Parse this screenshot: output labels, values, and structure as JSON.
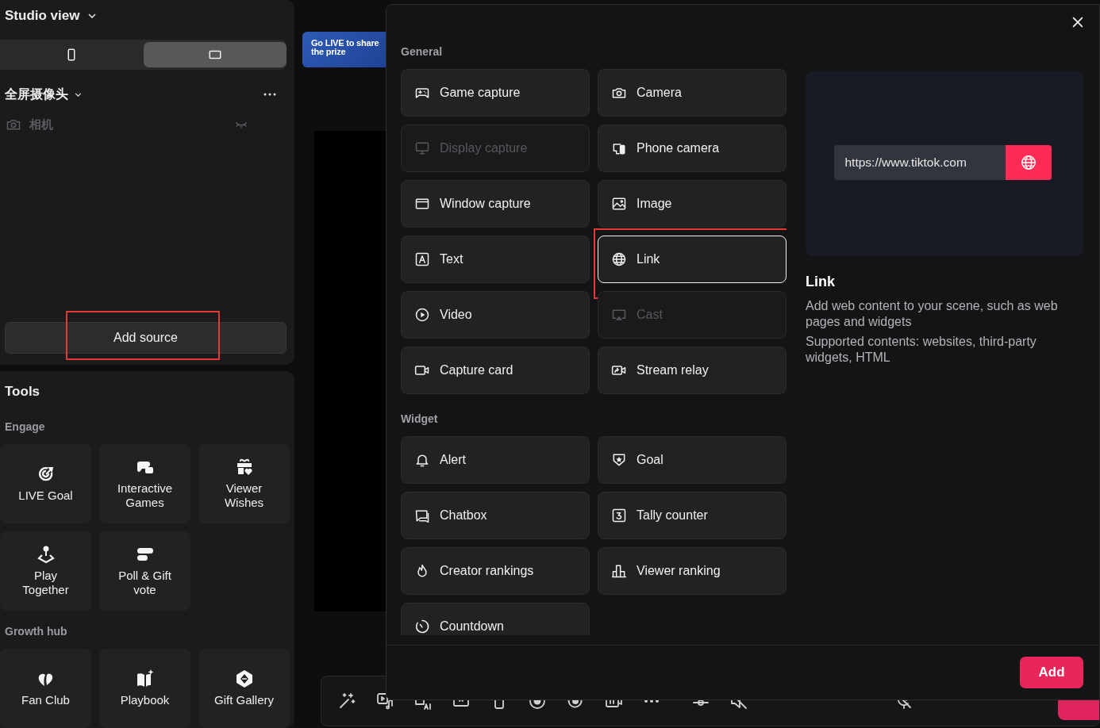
{
  "sidebar": {
    "title": "Studio view",
    "layout_tabs": [
      {
        "selected": false
      },
      {
        "selected": true
      }
    ],
    "scene": {
      "name": "全屏摄像头"
    },
    "sources": [
      {
        "name": "相机",
        "visible": false
      }
    ],
    "add_source": {
      "label": "Add source",
      "annotated": true
    }
  },
  "tools": {
    "title": "Tools",
    "groups": [
      {
        "title": "Engage",
        "items": [
          "LIVE Goal",
          "Interactive Games",
          "Viewer Wishes",
          "Play Together",
          "Poll & Gift vote"
        ]
      },
      {
        "title": "Growth hub",
        "items": [
          "Fan Club",
          "Playbook",
          "Gift Gallery"
        ]
      }
    ]
  },
  "banner": {
    "text": "Go LIVE to share the prize"
  },
  "dialog": {
    "sections": [
      {
        "title": "General",
        "items": [
          {
            "label": "Game capture",
            "disabled": false,
            "selected": false,
            "annotated": false
          },
          {
            "label": "Camera",
            "disabled": false,
            "selected": false,
            "annotated": false
          },
          {
            "label": "Display capture",
            "disabled": true,
            "selected": false,
            "annotated": false
          },
          {
            "label": "Phone camera",
            "disabled": false,
            "selected": false,
            "annotated": false
          },
          {
            "label": "Window capture",
            "disabled": false,
            "selected": false,
            "annotated": false
          },
          {
            "label": "Image",
            "disabled": false,
            "selected": false,
            "annotated": false
          },
          {
            "label": "Text",
            "disabled": false,
            "selected": false,
            "annotated": false
          },
          {
            "label": "Link",
            "disabled": false,
            "selected": true,
            "annotated": true
          },
          {
            "label": "Video",
            "disabled": false,
            "selected": false,
            "annotated": false
          },
          {
            "label": "Cast",
            "disabled": true,
            "selected": false,
            "annotated": false
          },
          {
            "label": "Capture card",
            "disabled": false,
            "selected": false,
            "annotated": false
          },
          {
            "label": "Stream relay",
            "disabled": false,
            "selected": false,
            "annotated": false
          }
        ]
      },
      {
        "title": "Widget",
        "items": [
          {
            "label": "Alert",
            "disabled": false,
            "selected": false,
            "annotated": false
          },
          {
            "label": "Goal",
            "disabled": false,
            "selected": false,
            "annotated": false
          },
          {
            "label": "Chatbox",
            "disabled": false,
            "selected": false,
            "annotated": false
          },
          {
            "label": "Tally counter",
            "disabled": false,
            "selected": false,
            "annotated": false
          },
          {
            "label": "Creator rankings",
            "disabled": false,
            "selected": false,
            "annotated": false
          },
          {
            "label": "Viewer ranking",
            "disabled": false,
            "selected": false,
            "annotated": false
          },
          {
            "label": "Countdown",
            "disabled": false,
            "selected": false,
            "annotated": false
          }
        ]
      }
    ],
    "preview": {
      "url": "https://www.tiktok.com"
    },
    "detail": {
      "title": "Link",
      "paragraphs": [
        "Add web content to your scene, such as web pages and widgets",
        "Supported contents: websites, third-party widgets, HTML"
      ]
    },
    "add_button": "Add"
  }
}
